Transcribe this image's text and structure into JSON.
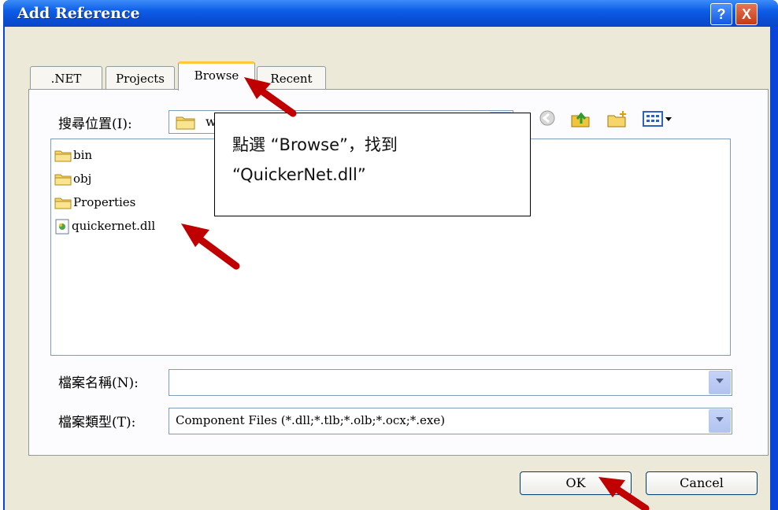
{
  "window": {
    "title": "Add Reference",
    "help": "?",
    "close": "X"
  },
  "tabs": [
    {
      "label": ".NET"
    },
    {
      "label": "Projects"
    },
    {
      "label": "Browse"
    },
    {
      "label": "Recent"
    }
  ],
  "look_in": {
    "label": "搜尋位置(I):",
    "value": "w"
  },
  "toolbar_icons": [
    "back-icon",
    "up-folder-icon",
    "new-folder-icon",
    "view-menu-icon"
  ],
  "files": [
    {
      "name": "bin",
      "icon": "folder-icon"
    },
    {
      "name": "obj",
      "icon": "folder-icon"
    },
    {
      "name": "Properties",
      "icon": "folder-icon"
    },
    {
      "name": "quickernet.dll",
      "icon": "dll-file-icon"
    }
  ],
  "file_name": {
    "label": "檔案名稱(N):",
    "value": ""
  },
  "file_type": {
    "label": "檔案類型(T):",
    "value": "Component Files (*.dll;*.tlb;*.olb;*.ocx;*.exe)"
  },
  "buttons": {
    "ok": "OK",
    "cancel": "Cancel"
  },
  "callout": {
    "line1": "點選 “Browse”，找到",
    "line2": "“QuickerNet.dll”"
  },
  "colors": {
    "titlebar": "#0a4fd6",
    "dialog_bg": "#ece9d8",
    "arrow": "#c00000",
    "tab_highlight": "#ffc83c"
  }
}
